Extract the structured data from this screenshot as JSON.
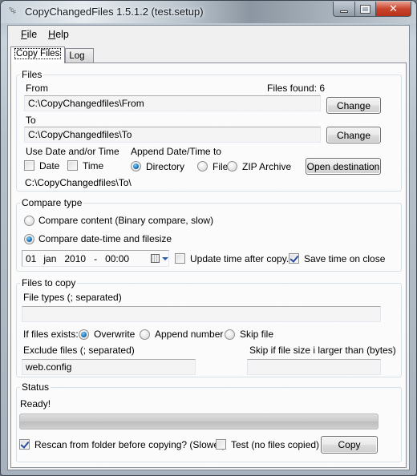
{
  "window": {
    "title": "CopyChangedFiles 1.5.1.2 (test.setup)",
    "controls": {
      "minimize": "minimize",
      "maximize": "maximize",
      "close": "✕"
    }
  },
  "menu": {
    "items": [
      {
        "label": "File",
        "accel": "F",
        "rest": "ile"
      },
      {
        "label": "Help",
        "accel": "H",
        "rest": "elp"
      }
    ]
  },
  "tabs": [
    {
      "label": "Copy Files",
      "active": true
    },
    {
      "label": "Log",
      "active": false
    }
  ],
  "files_group": {
    "title": "Files",
    "from_label": "From",
    "files_found": "Files found: 6",
    "from_value": "C:\\CopyChangedfiles\\From",
    "change_from": "Change",
    "to_label": "To",
    "to_value": "C:\\CopyChangedfiles\\To",
    "change_to": "Change",
    "use_date_time_label": "Use Date and/or Time",
    "date_label": "Date",
    "date_checked": false,
    "time_label": "Time",
    "time_checked": false,
    "append_label": "Append Date/Time to",
    "append_options": [
      {
        "label": "Directory",
        "checked": true
      },
      {
        "label": "File",
        "checked": false
      },
      {
        "label": "ZIP Archive",
        "checked": false
      }
    ],
    "open_destination": "Open destination",
    "destination_preview": "C:\\CopyChangedfiles\\To\\"
  },
  "compare_group": {
    "title": "Compare type",
    "options": [
      {
        "label": "Compare content (Binary compare, slow)",
        "checked": false
      },
      {
        "label": "Compare date-time and filesize",
        "checked": true
      }
    ],
    "date": {
      "day": "01",
      "month": "jan",
      "year": "2010",
      "sep": "-",
      "time": "00:00"
    },
    "update_time_label": "Update time after copy.",
    "update_time_checked": false,
    "save_time_label": "Save time on close",
    "save_time_checked": true
  },
  "files_to_copy_group": {
    "title": "Files to copy",
    "file_types_label": "File types (; separated)",
    "file_types_value": "",
    "if_exists_label": "If files exists:",
    "if_exists_options": [
      {
        "label": "Overwrite",
        "checked": true
      },
      {
        "label": "Append number",
        "checked": false
      },
      {
        "label": "Skip file",
        "checked": false
      }
    ],
    "exclude_label": "Exclude files (; separated)",
    "exclude_value": "web.config",
    "skip_size_label": "Skip if file size i larger than (bytes)",
    "skip_size_value": ""
  },
  "status_group": {
    "title": "Status",
    "status_text": "Ready!",
    "progress": 0,
    "rescan_label": "Rescan from folder before copying? (Slower)",
    "rescan_checked": true,
    "test_label": "Test (no files copied)",
    "test_checked": false,
    "copy_button": "Copy"
  }
}
